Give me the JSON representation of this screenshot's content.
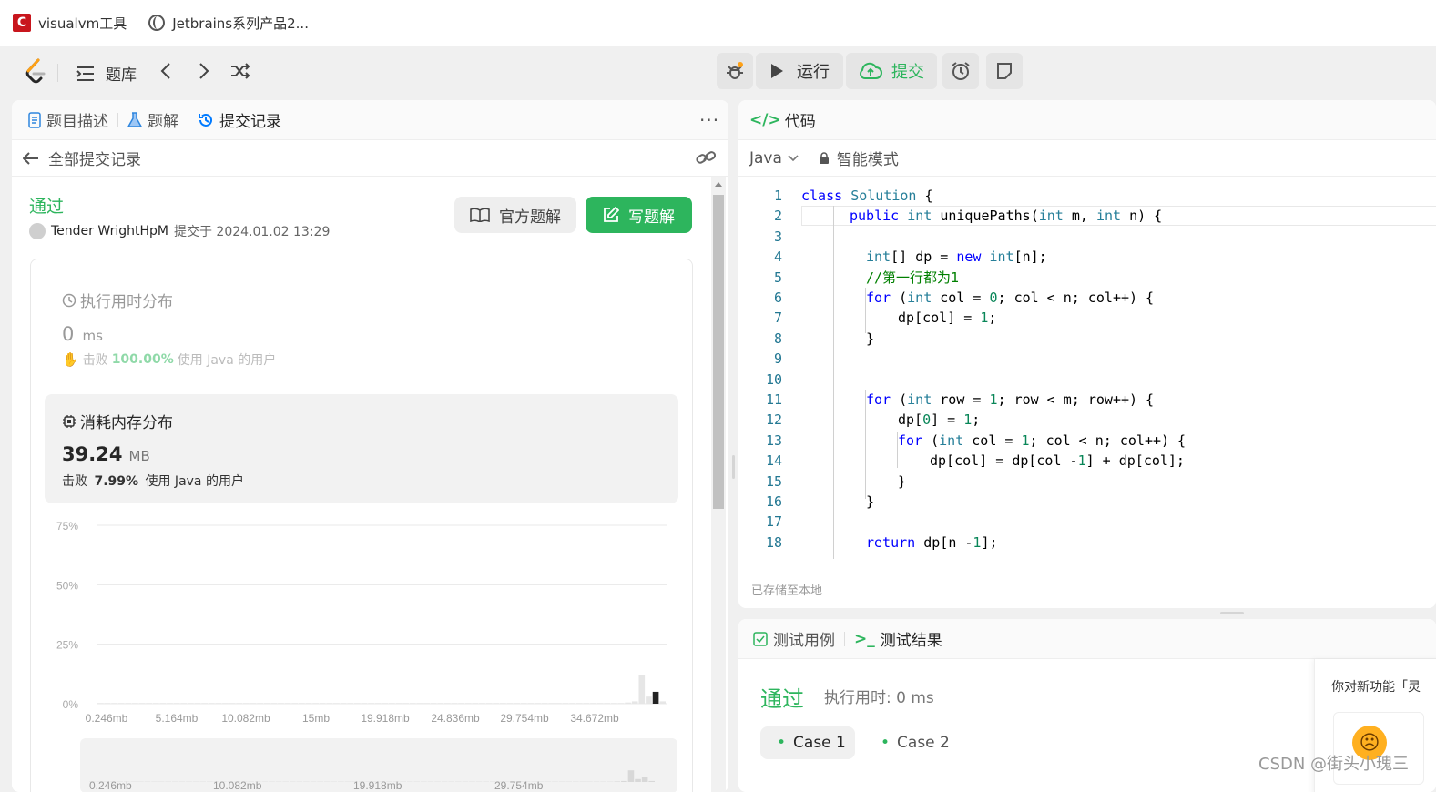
{
  "bookmarks": [
    {
      "label": "visualvm工具",
      "icon": "csdn-c-icon"
    },
    {
      "label": "Jetbrains系列产品2...",
      "icon": "globe-icon"
    }
  ],
  "nav": {
    "problems_label": "题库",
    "run_label": "运行",
    "submit_label": "提交"
  },
  "left_panel": {
    "tabs": [
      "题目描述",
      "题解",
      "提交记录"
    ],
    "back_label": "全部提交记录",
    "status": "通过",
    "user": "Tender WrightHpM",
    "submitted_text": "提交于 2024.01.02 13:29",
    "official_solution_label": "官方题解",
    "write_solution_label": "写题解",
    "runtime": {
      "title": "执行用时分布",
      "value": "0",
      "unit": "ms",
      "beats_prefix": "击败",
      "beats_value": "100.00%",
      "beats_suffix": "使用 Java 的用户"
    },
    "memory": {
      "title": "消耗内存分布",
      "value": "39.24",
      "unit": "MB",
      "beats_prefix": "击败",
      "beats_value": "7.99%",
      "beats_suffix": "使用 Java 的用户"
    },
    "chart_data": {
      "type": "bar",
      "y_ticks": [
        "75%",
        "50%",
        "25%",
        "0%"
      ],
      "x_ticks": [
        "0.246mb",
        "5.164mb",
        "10.082mb",
        "15mb",
        "19.918mb",
        "24.836mb",
        "29.754mb",
        "34.672mb"
      ],
      "mini_x_ticks": [
        "0.246mb",
        "10.082mb",
        "19.918mb",
        "29.754mb"
      ],
      "ylim": [
        0,
        75
      ],
      "values": [
        0.3,
        0.3,
        0.3,
        0.3,
        0.3,
        0.3,
        0.3,
        0.3,
        0.3,
        0.3,
        0.3,
        0.3,
        0.3,
        0.3,
        0.3,
        0.3,
        0.3,
        0.3,
        0.3,
        0.3,
        0.3,
        0.3,
        0.3,
        0.3,
        0.3,
        0.3,
        0.3,
        0.3,
        0.3,
        0.3,
        0.3,
        0.3,
        0.3,
        0.3,
        0.3,
        0.3,
        0.3,
        0.3,
        0.3,
        0.3,
        0.3,
        0.3,
        0.3,
        0.3,
        0.3,
        0.3,
        0.3,
        0.3,
        0.3,
        0.3,
        0.3,
        0.3,
        0.3,
        0.3,
        0.3,
        0.3,
        0.3,
        0.3,
        0.3,
        0.3,
        0.3,
        0.3,
        0.3,
        0.3,
        0.3,
        0.3,
        0.3,
        0.3,
        0.3,
        0.3,
        0.3,
        0.3,
        0.3,
        0.3,
        0.3,
        0.3,
        0.5,
        1,
        12,
        3,
        5,
        1
      ],
      "highlight_index": 80
    }
  },
  "code_panel": {
    "title": "代码",
    "language": "Java",
    "mode": "智能模式",
    "saved_text": "已存储至本地",
    "lines": [
      {
        "n": "1",
        "indent": 0
      },
      {
        "n": "2",
        "indent": 1
      },
      {
        "n": "3",
        "indent": 0
      },
      {
        "n": "4",
        "indent": 2
      },
      {
        "n": "5",
        "indent": 2
      },
      {
        "n": "6",
        "indent": 2
      },
      {
        "n": "7",
        "indent": 3
      },
      {
        "n": "8",
        "indent": 2
      },
      {
        "n": "9",
        "indent": 0
      },
      {
        "n": "10",
        "indent": 0
      },
      {
        "n": "11",
        "indent": 2
      },
      {
        "n": "12",
        "indent": 3
      },
      {
        "n": "13",
        "indent": 3
      },
      {
        "n": "14",
        "indent": 4
      },
      {
        "n": "15",
        "indent": 3
      },
      {
        "n": "16",
        "indent": 2
      },
      {
        "n": "17",
        "indent": 0
      },
      {
        "n": "18",
        "indent": 2
      }
    ],
    "code_text": [
      "class Solution {",
      "public int uniquePaths(int m, int n) {",
      "",
      "int[] dp = new int[n];",
      "//第一行都为1",
      "for (int col = 0; col < n; col++) {",
      "dp[col] = 1;",
      "}",
      "",
      "",
      "for (int row = 1; row < m; row++) {",
      "dp[0] = 1;",
      "for (int col = 1; col < n; col++) {",
      "dp[col] = dp[col -1] + dp[col];",
      "}",
      "}",
      "",
      "return dp[n -1];"
    ]
  },
  "test_panel": {
    "tab_cases": "测试用例",
    "tab_results": "测试结果",
    "status": "通过",
    "runtime_text": "执行用时: 0 ms",
    "cases": [
      "Case 1",
      "Case 2"
    ],
    "feedback_text": "你对新功能「灵"
  },
  "watermark": "CSDN @街头小瑰三",
  "colors": {
    "accent_green": "#2db55d",
    "link_blue": "#007aff"
  }
}
